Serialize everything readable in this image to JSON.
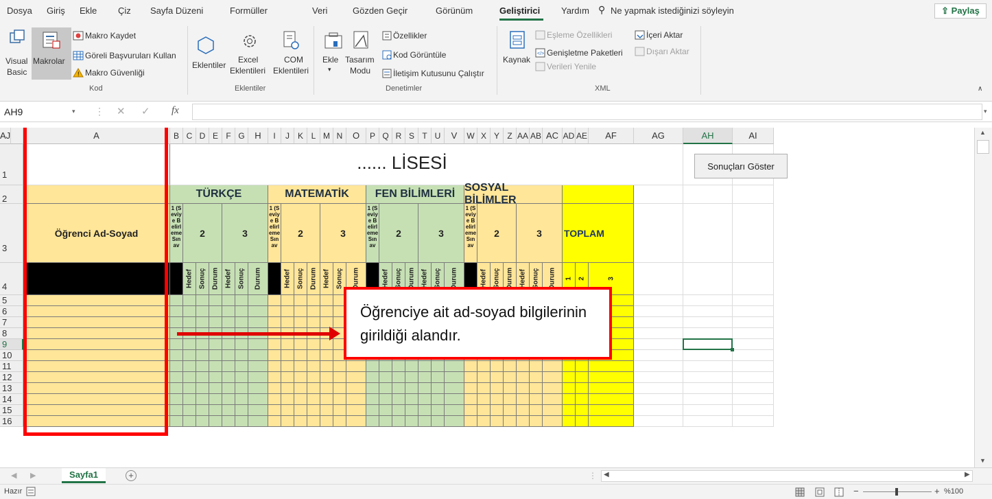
{
  "menu": {
    "items": [
      "Dosya",
      "Giriş",
      "Ekle",
      "Çiz",
      "Sayfa Düzeni",
      "Formüller",
      "Veri",
      "Gözden Geçir",
      "Görünüm",
      "Geliştirici",
      "Yardım"
    ],
    "search": "Ne yapmak istediğinizi söyleyin",
    "share": "Paylaş"
  },
  "ribbon": {
    "code": {
      "visual_basic": [
        "Visual",
        "Basic"
      ],
      "macros": "Makrolar",
      "record_macro": "Makro Kaydet",
      "relative_refs": "Göreli Başvuruları Kullan",
      "macro_security": "Makro Güvenliği",
      "label": "Kod"
    },
    "addins": {
      "addins": "Eklentiler",
      "excel_addins": [
        "Excel",
        "Eklentileri"
      ],
      "com_addins": [
        "COM",
        "Eklentileri"
      ],
      "label": "Eklentiler"
    },
    "controls": {
      "insert": "Ekle",
      "design_mode": [
        "Tasarım",
        "Modu"
      ],
      "properties": "Özellikler",
      "view_code": "Kod Görüntüle",
      "run_dialog": "İletişim Kutusunu Çalıştır",
      "label": "Denetimler"
    },
    "xml": {
      "source": "Kaynak",
      "map_props": "Eşleme Özellikleri",
      "expansion": "Genişletme Paketleri",
      "refresh": "Verileri Yenile",
      "import": "İçeri Aktar",
      "export": "Dışarı Aktar",
      "label": "XML"
    }
  },
  "formula": {
    "namebox": "AH9",
    "fx": "fx"
  },
  "columns": [
    "A",
    "B",
    "C",
    "D",
    "E",
    "F",
    "G",
    "H",
    "I",
    "J",
    "K",
    "L",
    "M",
    "N",
    "O",
    "P",
    "Q",
    "R",
    "S",
    "T",
    "U",
    "V",
    "W",
    "X",
    "Y",
    "Z",
    "AA",
    "AB",
    "AC",
    "AD",
    "AE",
    "AF",
    "AG",
    "AH",
    "AI",
    "AJ"
  ],
  "rows": [
    "1",
    "2",
    "3",
    "4",
    "5",
    "6",
    "7",
    "8",
    "9",
    "10",
    "11",
    "12",
    "13",
    "14",
    "15",
    "16"
  ],
  "sheet": {
    "title": "...... LİSESİ",
    "button": "Sonuçları Göster",
    "student_header": "Öğrenci Ad-Soyad",
    "subjects": [
      "TÜRKÇE",
      "MATEMATİK",
      "FEN BİLİMLERİ",
      "SOSYAL BİLİMLER"
    ],
    "exam1": "1 (Seviye Belirleme Sınav",
    "exam2": "2",
    "exam3": "3",
    "total": "TOPLAM",
    "sub": [
      "Hedef",
      "Sonuç",
      "Durum"
    ],
    "total_sub": [
      "1",
      "2",
      "3"
    ]
  },
  "callout": "Öğrenciye ait ad-soyad bilgilerinin girildiği alandır.",
  "tabs": {
    "sheet1": "Sayfa1",
    "add": "+"
  },
  "status": {
    "ready": "Hazır",
    "zoom": "%100"
  },
  "colors": {
    "green": "#c6e0b4",
    "orange": "#ffe699",
    "yellow": "#ffff00",
    "accent": "#217346",
    "red": "#ff0000"
  }
}
